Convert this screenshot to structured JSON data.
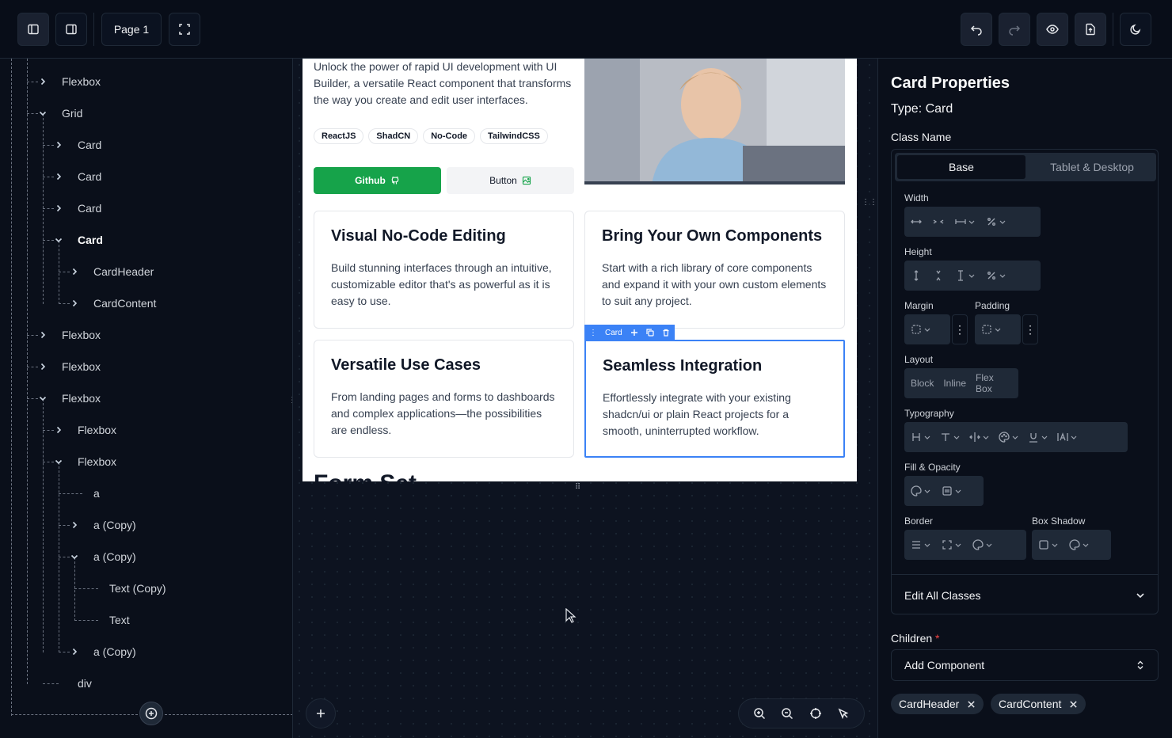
{
  "topbar": {
    "page_label": "Page 1"
  },
  "tree": {
    "items": [
      {
        "label": "Flexbox"
      },
      {
        "label": "Grid"
      },
      {
        "label": "Card"
      },
      {
        "label": "Card"
      },
      {
        "label": "Card"
      },
      {
        "label": "Card"
      },
      {
        "label": "CardHeader"
      },
      {
        "label": "CardContent"
      },
      {
        "label": "Flexbox"
      },
      {
        "label": "Flexbox"
      },
      {
        "label": "Flexbox"
      },
      {
        "label": "Flexbox"
      },
      {
        "label": "Flexbox"
      },
      {
        "label": "a"
      },
      {
        "label": "a (Copy)"
      },
      {
        "label": "a (Copy)"
      },
      {
        "label": "Text (Copy)"
      },
      {
        "label": "Text"
      },
      {
        "label": "a (Copy)"
      },
      {
        "label": "div"
      }
    ]
  },
  "canvas": {
    "hero_text": "Unlock the power of rapid UI development with UI Builder, a versatile React component that transforms the way you create and edit user interfaces.",
    "tags": [
      "ReactJS",
      "ShadCN",
      "No-Code",
      "TailwindCSS"
    ],
    "github_button": "Github",
    "plain_button": "Button",
    "features": [
      {
        "title": "Visual No-Code Editing",
        "body": "Build stunning interfaces through an intuitive, customizable editor that's as powerful as it is easy to use."
      },
      {
        "title": "Bring Your Own Components",
        "body": "Start with a rich library of core components and expand it with your own custom elements to suit any project."
      },
      {
        "title": "Versatile Use Cases",
        "body": "From landing pages and forms to dashboards and complex applications—the possibilities are endless."
      },
      {
        "title": "Seamless Integration",
        "body": "Effortlessly integrate with your existing shadcn/ui or plain React projects for a smooth, uninterrupted workflow."
      }
    ],
    "selection_label": "Card",
    "cut_heading": "Form Set"
  },
  "props": {
    "title": "Card Properties",
    "type": "Type: Card",
    "class_name_label": "Class Name",
    "tabs": [
      "Base",
      "Tablet & Desktop"
    ],
    "width_label": "Width",
    "height_label": "Height",
    "margin_label": "Margin",
    "padding_label": "Padding",
    "layout_label": "Layout",
    "layout_options": [
      "Block",
      "Inline",
      "Flex Box"
    ],
    "typography_label": "Typography",
    "fill_label": "Fill & Opacity",
    "border_label": "Border",
    "shadow_label": "Box Shadow",
    "edit_all": "Edit All Classes",
    "children_label": "Children",
    "required_mark": "*",
    "add_component": "Add Component",
    "chips": [
      "CardHeader",
      "CardContent"
    ]
  }
}
